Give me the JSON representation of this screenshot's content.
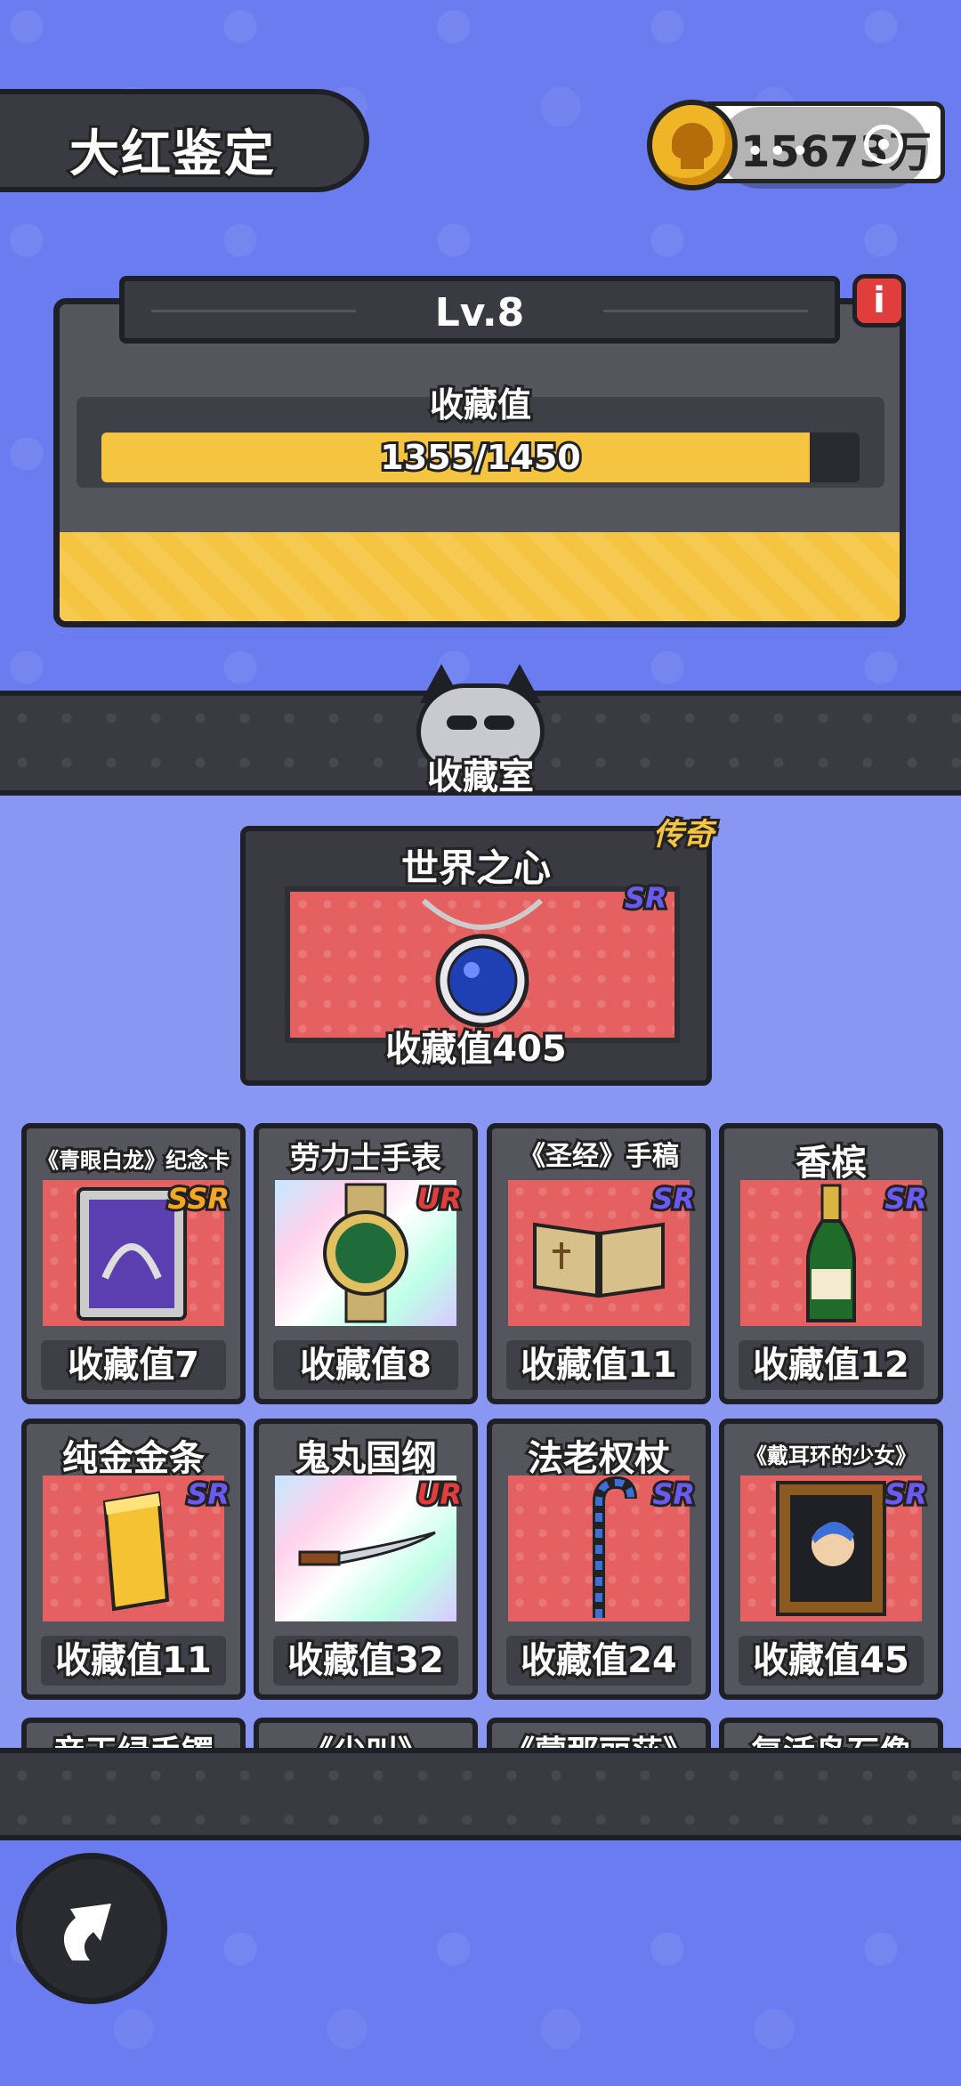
{
  "header": {
    "title": "大红鉴定",
    "coins": "15673万"
  },
  "level": {
    "label": "Lv.8",
    "collect_label": "收藏值",
    "progress_text": "1355/1450",
    "progress_fraction": 0.934
  },
  "room": {
    "title": "收藏室"
  },
  "featured": {
    "name": "世界之心",
    "tag": "传奇",
    "rarity": "SR",
    "value": "收藏值405"
  },
  "items": [
    {
      "name": "《青眼白龙》纪念卡",
      "rarity": "SSR",
      "value": "收藏值7"
    },
    {
      "name": "劳力士手表",
      "rarity": "UR",
      "value": "收藏值8"
    },
    {
      "name": "《圣经》手稿",
      "rarity": "SR",
      "value": "收藏值11"
    },
    {
      "name": "香槟",
      "rarity": "SR",
      "value": "收藏值12"
    },
    {
      "name": "纯金金条",
      "rarity": "SR",
      "value": "收藏值11"
    },
    {
      "name": "鬼丸国纲",
      "rarity": "UR",
      "value": "收藏值32"
    },
    {
      "name": "法老权杖",
      "rarity": "SR",
      "value": "收藏值24"
    },
    {
      "name": "《戴耳环的少女》",
      "rarity": "SR",
      "value": "收藏值45"
    }
  ],
  "peek_items": [
    "帝王绿手镯",
    "《尖叫》",
    "《蒙那丽莎》",
    "复活岛石像"
  ],
  "colors": {
    "background": "#6a7cf0",
    "accent_yellow": "#f5c542",
    "panel": "#3a3b42",
    "card_art": "#e56161"
  }
}
